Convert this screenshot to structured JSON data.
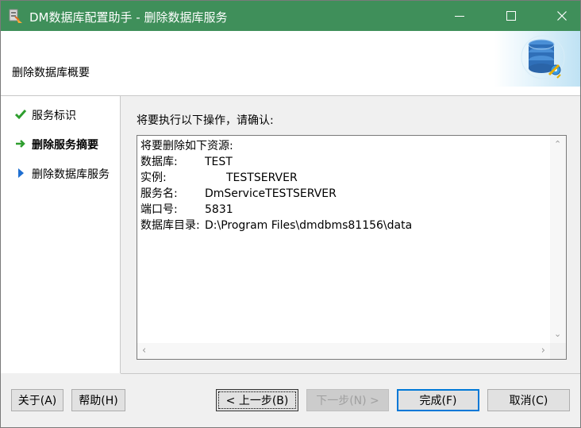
{
  "window": {
    "title": "DM数据库配置助手 - 删除数据库服务",
    "title_bar_color": "#3f8f5a",
    "icons": {
      "app": "dm-app-icon",
      "minimize": "minimize-icon",
      "maximize": "maximize-icon",
      "close": "close-icon"
    }
  },
  "header": {
    "title": "删除数据库概要",
    "art_icon": "database-gear-icon"
  },
  "steps": [
    {
      "label": "服务标识",
      "status": "done",
      "icon": "checkmark-icon"
    },
    {
      "label": "删除服务摘要",
      "status": "current",
      "icon": "arrow-right-icon"
    },
    {
      "label": "删除数据库服务",
      "status": "pending",
      "icon": "triangle-right-icon"
    }
  ],
  "main": {
    "prompt": "将要执行以下操作，请确认:",
    "summary": {
      "heading": "将要删除如下资源:",
      "rows": [
        {
          "key": "数据库:",
          "value": "TEST"
        },
        {
          "key": "实例:",
          "value": "TESTSERVER"
        },
        {
          "key": "服务名:",
          "value": "DmServiceTESTSERVER"
        },
        {
          "key": "端口号:",
          "value": "5831"
        },
        {
          "key": "数据库目录:",
          "value": "D:\\Program Files\\dmdbms81156\\data"
        }
      ]
    }
  },
  "buttons": {
    "about": "关于(A)",
    "help": "帮助(H)",
    "back": "< 上一步(B)",
    "next": "下一步(N) >",
    "finish": "完成(F)",
    "cancel": "取消(C)"
  },
  "colors": {
    "accent": "#0078d7",
    "check": "#2e9e2e",
    "current_arrow": "#2e9e2e",
    "pending_arrow": "#1f6fd1"
  }
}
